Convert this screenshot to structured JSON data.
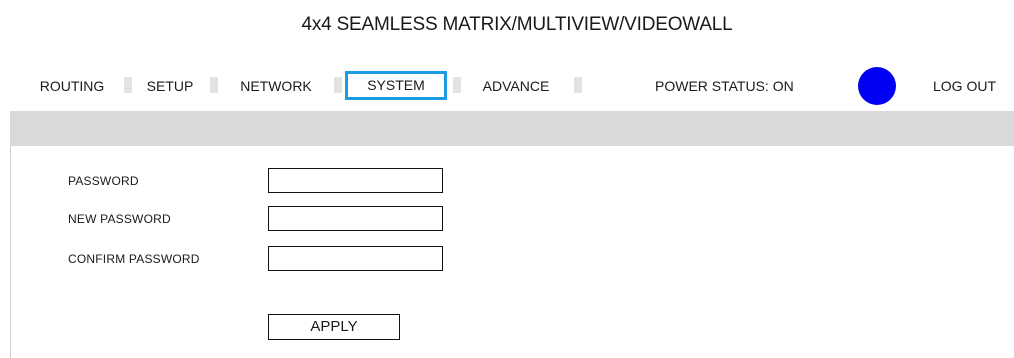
{
  "app": {
    "title": "4x4 SEAMLESS MATRIX/MULTIVIEW/VIDEOWALL"
  },
  "nav": {
    "tabs": [
      {
        "label": "ROUTING",
        "active": false
      },
      {
        "label": "SETUP",
        "active": false
      },
      {
        "label": "NETWORK",
        "active": false
      },
      {
        "label": "SYSTEM",
        "active": true
      },
      {
        "label": "ADVANCE",
        "active": false
      }
    ],
    "power_status": "POWER STATUS: ON",
    "power_indicator_color": "#0000f5",
    "logout_label": "LOG OUT"
  },
  "colors": {
    "active_tab_border": "#1e9be6",
    "header_bar": "#d9d9d9"
  },
  "form": {
    "password_label": "PASSWORD",
    "password_value": "",
    "new_password_label": "NEW PASSWORD",
    "new_password_value": "",
    "confirm_password_label": "CONFIRM PASSWORD",
    "confirm_password_value": "",
    "apply_label": "APPLY"
  }
}
